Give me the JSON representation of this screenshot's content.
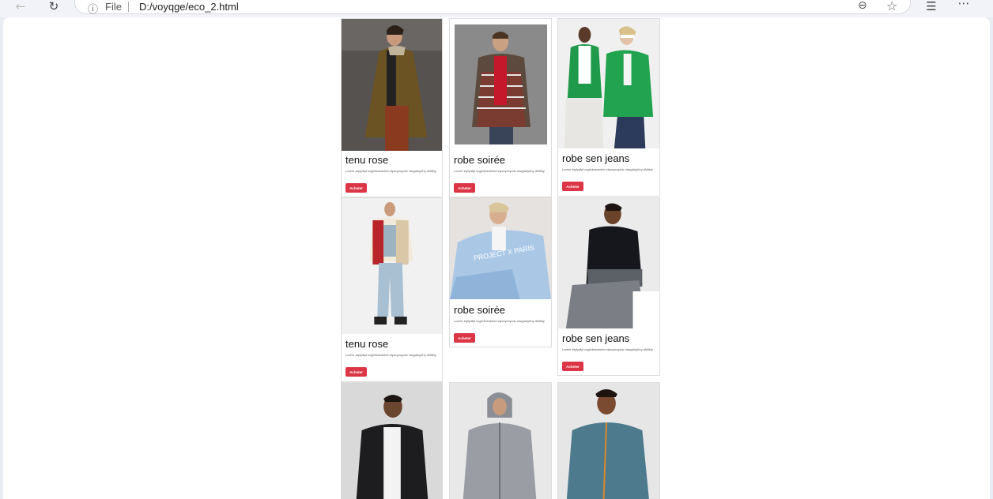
{
  "browser": {
    "info_icon": "info-icon",
    "file_label": "File",
    "url": "D:/voyqge/eco_2.html"
  },
  "colors": {
    "button_bg": "#dc3545",
    "page_bg": "#ffffff",
    "chrome_bg": "#f1f3f8"
  },
  "products": [
    {
      "title": "tenu rose",
      "desc": "Lorem ztyfydfyf vcgfcfxdxdxfxd ztyxcyxcyxdc ctsyykkyhhy dhlllkly",
      "button": "Acheter"
    },
    {
      "title": "robe soirée",
      "desc": "Lorem ztyfydfyf vcgfcfxdxdxfxd ztyxcyxcyxdc ctsyykkyhhy dhlllkly",
      "button": "Acheter"
    },
    {
      "title": "robe sen jeans",
      "desc": "Lorem ztyfydfyf vcgfcfxdxdxfxd ztyxcyxcyxdc ctsyykkyhhy dhlllkly",
      "button": "Acheter"
    },
    {
      "title": "tenu rose",
      "desc": "Lorem ztyfydfyf vcgfcfxdxdxfxd ztyxcyxcyxdc ctsyykkyhhy dhlllkly",
      "button": "Acheter"
    },
    {
      "title": "robe soirée",
      "desc": "Lorem ztyfydfyf vcgfcfxdxdxfxd ztyxcyxcyxdc ctsyykkyhhy dhlllkly",
      "button": "Acheter"
    },
    {
      "title": "robe sen jeans",
      "desc": "Lorem ztyfydfyf vcgfcfxdxdxfxd ztyxcyxcyxdc ctsyykkyhhy dhlllkly",
      "button": "Acheter"
    }
  ]
}
